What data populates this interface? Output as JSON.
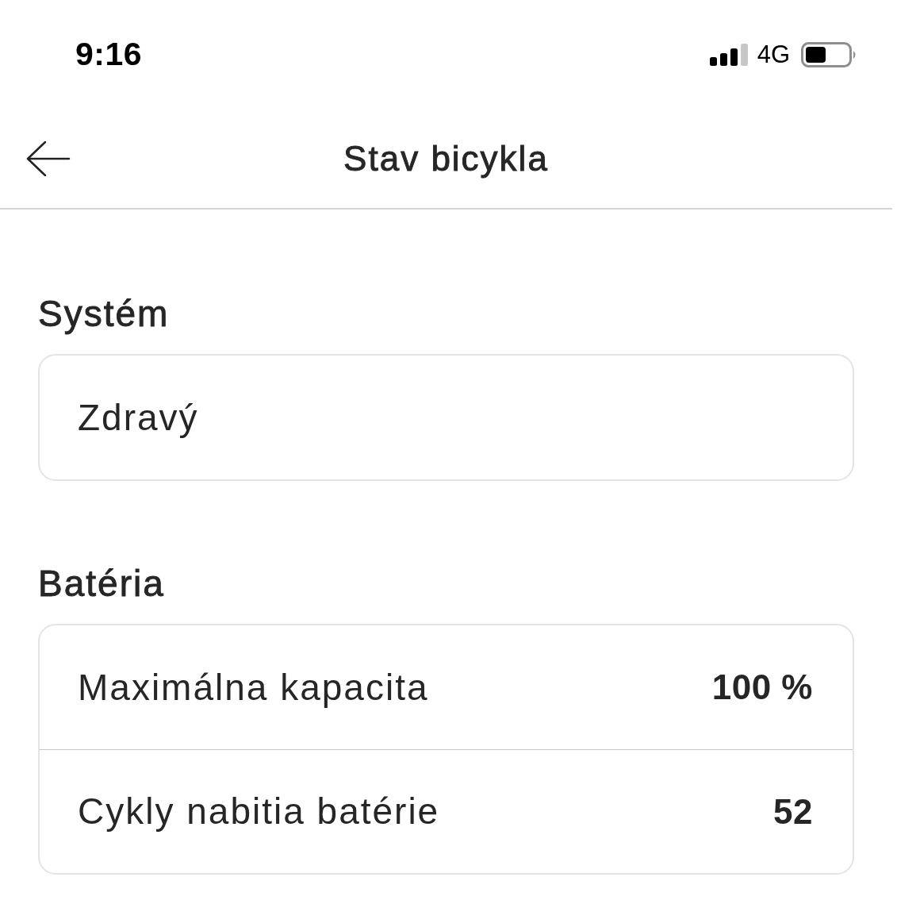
{
  "status_bar": {
    "time": "9:16",
    "network": "4G"
  },
  "header": {
    "title": "Stav bicykla"
  },
  "sections": [
    {
      "title": "Systém",
      "rows": [
        {
          "kind": "text",
          "label": "Zdravý"
        }
      ]
    },
    {
      "title": "Batéria",
      "rows": [
        {
          "kind": "pair",
          "label": "Maximálna kapacita",
          "value": "100 %"
        },
        {
          "kind": "pair",
          "label": "Cykly nabitia batérie",
          "value": "52"
        }
      ]
    }
  ]
}
